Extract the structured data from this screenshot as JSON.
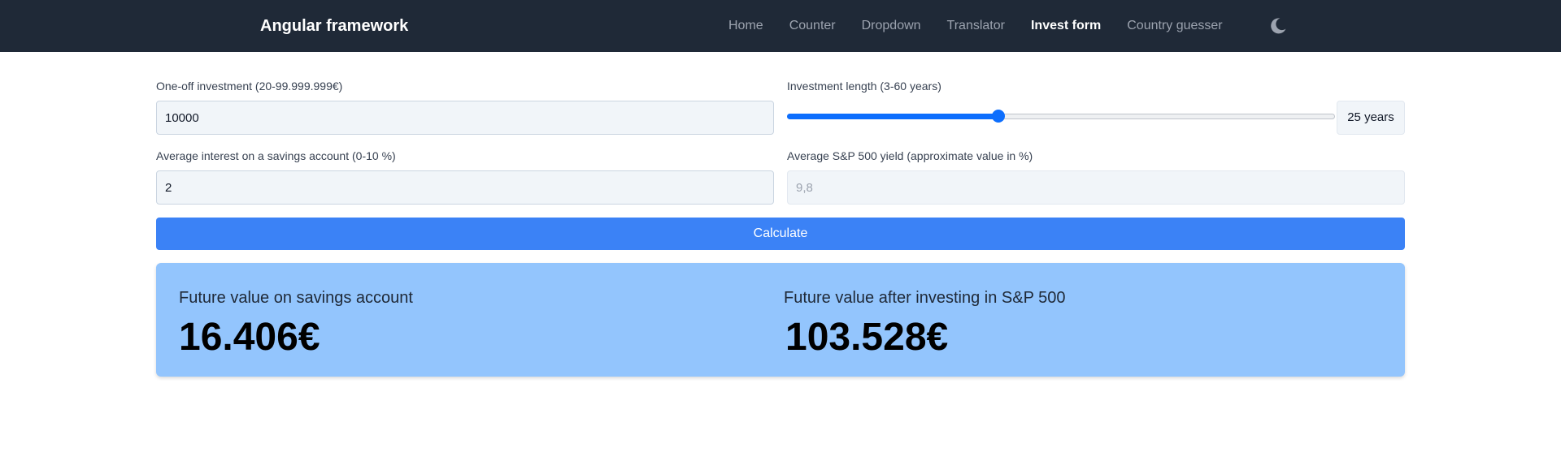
{
  "nav": {
    "brand": "Angular framework",
    "links": [
      {
        "label": "Home"
      },
      {
        "label": "Counter"
      },
      {
        "label": "Dropdown"
      },
      {
        "label": "Translator"
      },
      {
        "label": "Invest form"
      },
      {
        "label": "Country guesser"
      }
    ],
    "active_link": "Invest form",
    "theme_toggle_icon": "moon-icon"
  },
  "form": {
    "one_off_label": "One-off investment (20-99.999.999€)",
    "one_off_value": "10000",
    "length_label": "Investment length (3-60 years)",
    "length_min": 3,
    "length_max": 60,
    "length_value": 25,
    "length_badge": "25 years",
    "interest_label": "Average interest on a savings account (0-10 %)",
    "interest_value": "2",
    "sp500_label": "Average S&P 500 yield (approximate value in %)",
    "sp500_placeholder": "9,8",
    "calculate_label": "Calculate"
  },
  "results": {
    "savings_title": "Future value on savings account",
    "savings_value": "16.406€",
    "sp500_title": "Future value after investing in S&P 500",
    "sp500_value": "103.528€"
  },
  "colors": {
    "navbar_bg": "#1f2937",
    "accent": "#3b82f6",
    "slider": "#0d6efd",
    "results_bg": "#93c5fd"
  }
}
